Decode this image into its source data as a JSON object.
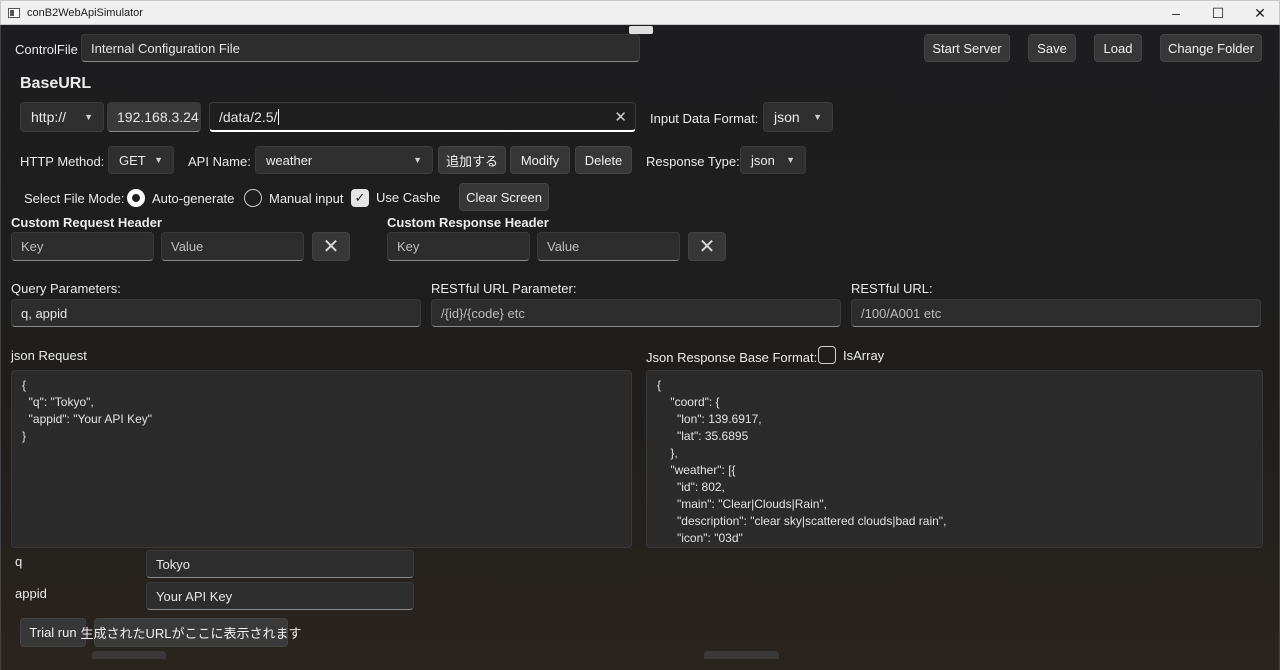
{
  "window": {
    "title": "conB2WebApiSimulator",
    "minimize_icon": "minimize-icon",
    "maximize_icon": "maximize-icon",
    "close_icon": "close-icon"
  },
  "control": {
    "label": "ControlFile",
    "value": "Internal Configuration File"
  },
  "toolbar": {
    "start_server": "Start Server",
    "save": "Save",
    "load": "Load",
    "change_folder": "Change Folder"
  },
  "base": {
    "heading": "BaseURL",
    "protocol": "http://",
    "host": "192.168.3.24",
    "path": "/data/2.5/",
    "input_format_label": "Input Data Format:",
    "input_format": "json"
  },
  "api": {
    "method_label": "HTTP Method:",
    "method": "GET",
    "name_label": "API Name:",
    "name": "weather",
    "add": "追加する",
    "modify": "Modify",
    "delete": "Delete",
    "response_type_label": "Response Type:",
    "response_type": "json"
  },
  "mode": {
    "label": "Select File Mode:",
    "auto": "Auto-generate",
    "manual": "Manual input",
    "cache": "Use Cashe",
    "clear": "Clear Screen"
  },
  "request_header": {
    "label": "Custom Request Header",
    "key_placeholder": "Key",
    "value_placeholder": "Value"
  },
  "response_header": {
    "label": "Custom Response Header",
    "key_placeholder": "Key",
    "value_placeholder": "Value"
  },
  "query": {
    "label": "Query Parameters:",
    "value": "q, appid"
  },
  "restful_param": {
    "label": "RESTful URL Parameter:",
    "placeholder": "/{id}/{code} etc"
  },
  "restful_url": {
    "label": "RESTful URL:",
    "placeholder": "/100/A001 etc"
  },
  "json_request": {
    "label": "json Request",
    "text": "{\n  \"q\": \"Tokyo\",\n  \"appid\": \"Your API Key\"\n}"
  },
  "json_response": {
    "label": "Json Response Base Format:",
    "is_array": "IsArray",
    "text": "{\n    \"coord\": {\n      \"lon\": 139.6917,\n      \"lat\": 35.6895\n    },\n    \"weather\": [{\n      \"id\": 802,\n      \"main\": \"Clear|Clouds|Rain\",\n      \"description\": \"clear sky|scattered clouds|bad rain\",\n      \"icon\": \"03d\""
  },
  "params": [
    {
      "name": "q",
      "value": "Tokyo"
    },
    {
      "name": "appid",
      "value": "Your API Key"
    }
  ],
  "trial": {
    "button": "Trial run",
    "url_placeholder": "生成されたURLがここに表示されます"
  }
}
